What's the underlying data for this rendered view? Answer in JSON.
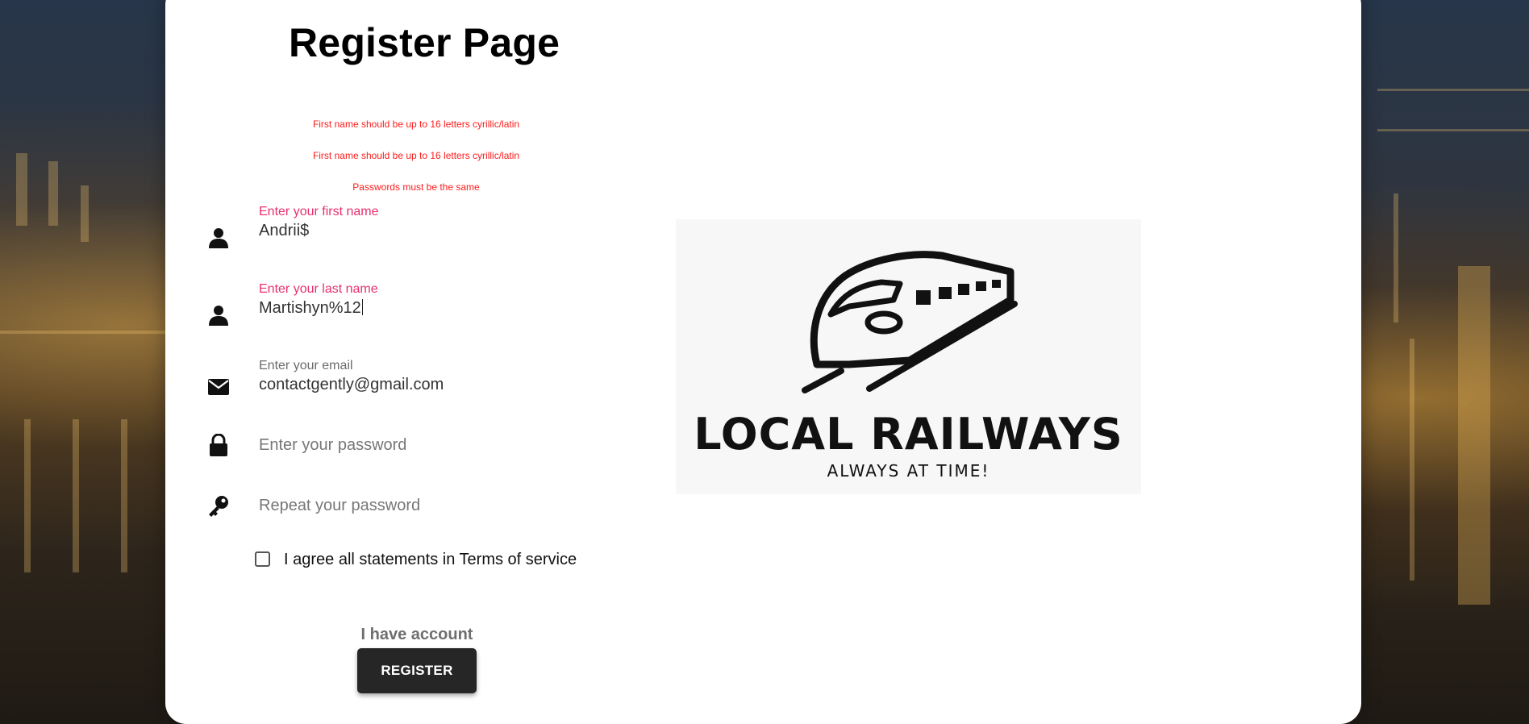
{
  "page": {
    "title": "Register Page"
  },
  "errors": [
    "First name should be up to 16 letters cyrillic/latin",
    "First name should be up to 16 letters cyrillic/latin",
    "Passwords must be the same"
  ],
  "form": {
    "first_name": {
      "label": "Enter your first name",
      "value": "Andrii$",
      "icon": "user-icon"
    },
    "last_name": {
      "label": "Enter your last name",
      "value": "Martishyn%12",
      "icon": "user-icon"
    },
    "email": {
      "label": "Enter your email",
      "value": "contactgently@gmail.com",
      "icon": "envelope-icon"
    },
    "password": {
      "placeholder": "Enter your password",
      "value": "",
      "icon": "lock-icon"
    },
    "repeat_password": {
      "placeholder": "Repeat your password",
      "value": "",
      "icon": "key-icon"
    },
    "terms": {
      "label": "I agree all statements in Terms of service",
      "checked": false
    }
  },
  "actions": {
    "have_account": "I have account",
    "register": "REGISTER"
  },
  "logo": {
    "title": "LOCAL RAILWAYS",
    "subtitle": "ALWAYS AT TIME!"
  },
  "colors": {
    "error_text": "#ff1a1a",
    "error_label": "#e8306c",
    "button_bg": "#262626"
  }
}
